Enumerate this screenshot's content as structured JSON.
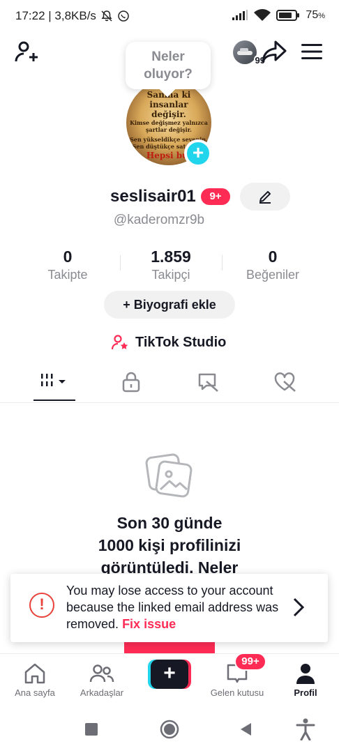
{
  "status_bar": {
    "time_speed": "17:22 | 3,8KB/s",
    "battery": "75",
    "battery_unit": "%"
  },
  "top_nav": {
    "stories_count": "99"
  },
  "note": {
    "line1": "Neler",
    "line2": "oluyor?"
  },
  "avatar_image_text": {
    "l1": "Sanma ki insanlar",
    "l2": "değişir.",
    "l3": "Kimse değişmez yalnızca",
    "l4": "şartlar değişir.",
    "l5": "Sen yükseldikçe sevenin,",
    "l6": "Sen düştükçe satanın...",
    "l7": "Hepsi bu."
  },
  "profile": {
    "username": "seslisair01",
    "badge": "9+",
    "handle": "@kaderomzr9b"
  },
  "stats": [
    {
      "value": "0",
      "label": "Takipte"
    },
    {
      "value": "1.859",
      "label": "Takipçi"
    },
    {
      "value": "0",
      "label": "Beğeniler"
    }
  ],
  "bio_button": "+ Biyografi ekle",
  "studio_label": "TikTok Studio",
  "tabs": [
    "videos",
    "private",
    "reposts",
    "liked"
  ],
  "empty_state": {
    "line1": "Son 30 günde",
    "line2": "1000 kişi profilinizi",
    "line3": "görüntüledi. Neler"
  },
  "toast": {
    "message": "You may lose access to your account because the linked email address was removed.",
    "action": "Fix issue"
  },
  "bottom_nav": {
    "home": "Ana sayfa",
    "friends": "Arkadaşlar",
    "inbox": "Gelen kutusu",
    "inbox_badge": "99+",
    "profile": "Profil"
  },
  "colors": {
    "brand_pink": "#fe2c55",
    "brand_cyan": "#20d5ec",
    "text_primary": "#161823",
    "text_secondary": "#8a8b91"
  }
}
